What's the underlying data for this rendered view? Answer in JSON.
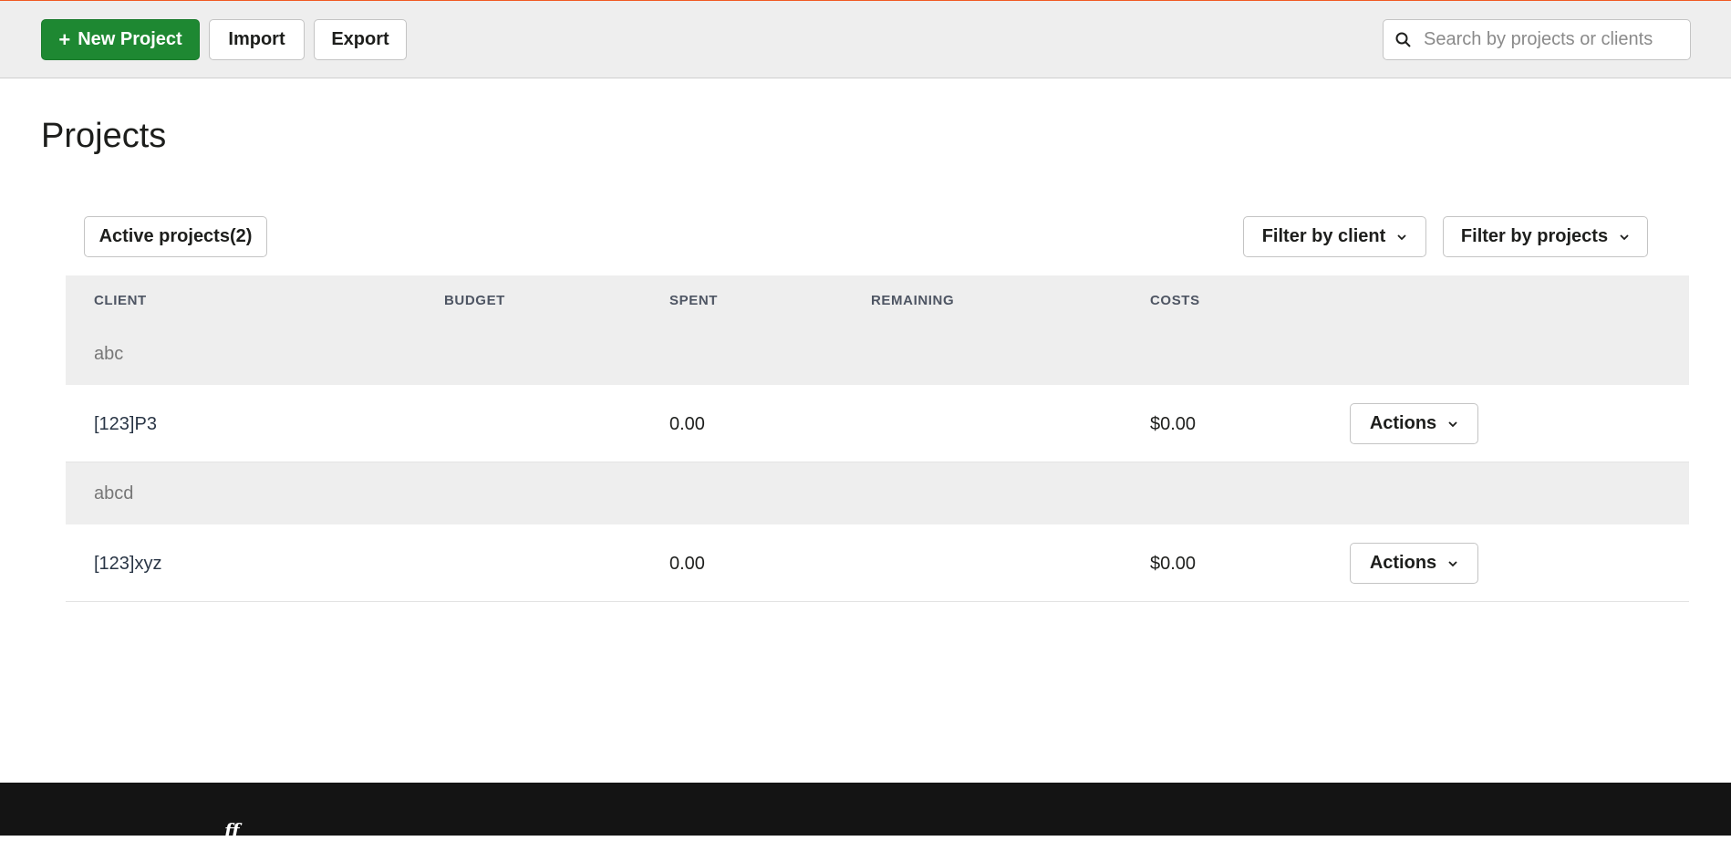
{
  "toolbar": {
    "new_project_label": "New Project",
    "import_label": "Import",
    "export_label": "Export",
    "search_placeholder": "Search by projects or clients",
    "accent_color": "#1e8832"
  },
  "page": {
    "title": "Projects"
  },
  "filters": {
    "active_projects_label": "Active projects(2)",
    "filter_client_label": "Filter by client",
    "filter_projects_label": "Filter by projects"
  },
  "table": {
    "columns": [
      "CLIENT",
      "BUDGET",
      "SPENT",
      "REMAINING",
      "COSTS"
    ],
    "groups": [
      {
        "client": "abc",
        "projects": [
          {
            "name": "[123]P3",
            "budget": "",
            "spent": "0.00",
            "remaining": "",
            "costs": "$0.00",
            "actions_label": "Actions"
          }
        ]
      },
      {
        "client": "abcd",
        "projects": [
          {
            "name": "[123]xyz",
            "budget": "",
            "spent": "0.00",
            "remaining": "",
            "costs": "$0.00",
            "actions_label": "Actions"
          }
        ]
      }
    ]
  },
  "footer": {
    "logo_text": "ff"
  }
}
